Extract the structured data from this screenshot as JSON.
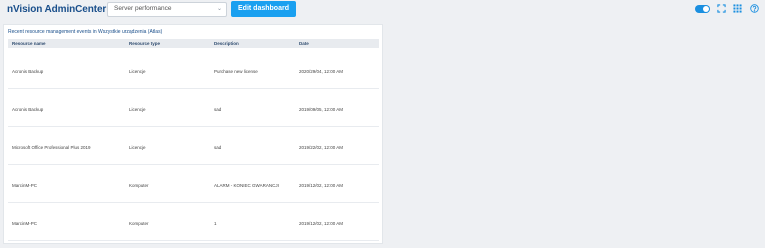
{
  "header": {
    "brand": "nVision AdminCenter",
    "dashboard_select": {
      "value": "Server performance"
    },
    "edit_button": "Edit dashboard",
    "icons": [
      "toggle-switch",
      "fullscreen-icon",
      "grid-icon",
      "help-icon"
    ],
    "accent_color": "#1aa0f0"
  },
  "panel": {
    "title": "Recent resource management events in Wszystkie urządzenia (Atlas)",
    "columns": [
      "Resource name",
      "Resource type",
      "Description",
      "Date"
    ],
    "rows": [
      [
        "Acronis Backup",
        "Licencje",
        "Purchase new license",
        "2020/29/04, 12:00 AM"
      ],
      [
        "Acronis Backup",
        "Licencje",
        "sad",
        "2019/09/05, 12:00 AM"
      ],
      [
        "Microsoft Office Professional Plus 2019",
        "Licencje",
        "sad",
        "2019/22/02, 12:00 AM"
      ],
      [
        "MarcinM-PC",
        "Komputer",
        "ALARM - KONIEC GWARANCJI",
        "2019/12/02, 12:00 AM"
      ],
      [
        "MarcinM-PC",
        "Komputer",
        "1",
        "2019/12/02, 12:00 AM"
      ]
    ]
  }
}
